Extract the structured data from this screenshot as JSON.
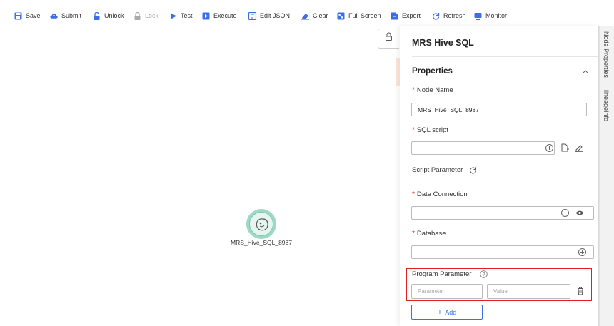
{
  "toolbar": {
    "items": [
      {
        "label": "Save",
        "icon": "save-icon",
        "disabled": false
      },
      {
        "label": "Submit",
        "icon": "cloud-upload-icon",
        "disabled": false
      },
      {
        "label": "Unlock",
        "icon": "unlock-icon",
        "disabled": false
      },
      {
        "label": "Lock",
        "icon": "lock-icon",
        "disabled": true
      },
      {
        "label": "Test",
        "icon": "play-icon",
        "disabled": false
      },
      {
        "label": "Execute",
        "icon": "execute-icon",
        "disabled": false
      },
      {
        "label": "Edit JSON",
        "icon": "json-icon",
        "disabled": false
      },
      {
        "label": "Clear",
        "icon": "eraser-icon",
        "disabled": false
      },
      {
        "label": "Full Screen",
        "icon": "fullscreen-icon",
        "disabled": false
      },
      {
        "label": "Export",
        "icon": "export-icon",
        "disabled": false
      },
      {
        "label": "Refresh",
        "icon": "refresh-icon",
        "disabled": false
      },
      {
        "label": "Monitor",
        "icon": "monitor-icon",
        "disabled": false
      }
    ]
  },
  "canvas": {
    "node": {
      "label": "MRS_Hive_SQL_8987",
      "icon": "hive-bee-icon"
    }
  },
  "panel": {
    "title": "MRS Hive SQL",
    "section": "Properties",
    "node_name": {
      "label": "Node Name",
      "value": "MRS_Hive_SQL_8987"
    },
    "sql_script": {
      "label": "SQL script",
      "value": ""
    },
    "script_parameter": {
      "label": "Script Parameter"
    },
    "data_connection": {
      "label": "Data Connection",
      "value": ""
    },
    "database": {
      "label": "Database",
      "value": ""
    },
    "program_parameter": {
      "label": "Program Parameter",
      "param_placeholder": "Parameter",
      "value_placeholder": "Value"
    },
    "add_label": "Add"
  },
  "right_tabs": [
    "Node Properties",
    "lineageInfo"
  ],
  "colors": {
    "accent": "#3b6ee8",
    "required": "#e02020",
    "highlight_box": "#e02020",
    "node_green": "#9fd8c4"
  }
}
